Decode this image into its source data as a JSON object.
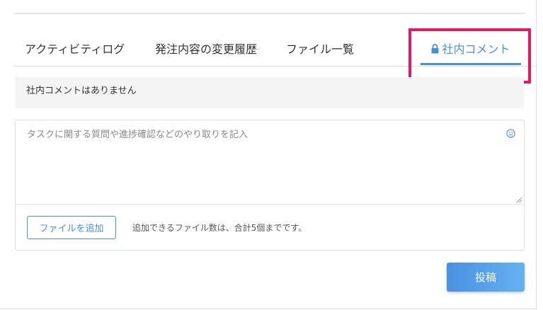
{
  "tabs": {
    "activity_log": "アクティビティログ",
    "order_history": "発注内容の変更履歴",
    "file_list": "ファイル一覧",
    "internal_comment": "社内コメント"
  },
  "internal_comments": {
    "empty_message": "社内コメントはありません",
    "input_placeholder": "タスクに関する質問や進捗確認などのやり取りを記入",
    "add_file_label": "ファイルを追加",
    "file_limit_note": "追加できるファイル数は、合計5個までです。",
    "post_label": "投稿"
  },
  "colors": {
    "accent": "#4a90d9",
    "highlight": "#e8185f"
  },
  "icons": {
    "tab_lock": "lock-icon",
    "emoji": "smile-icon"
  }
}
